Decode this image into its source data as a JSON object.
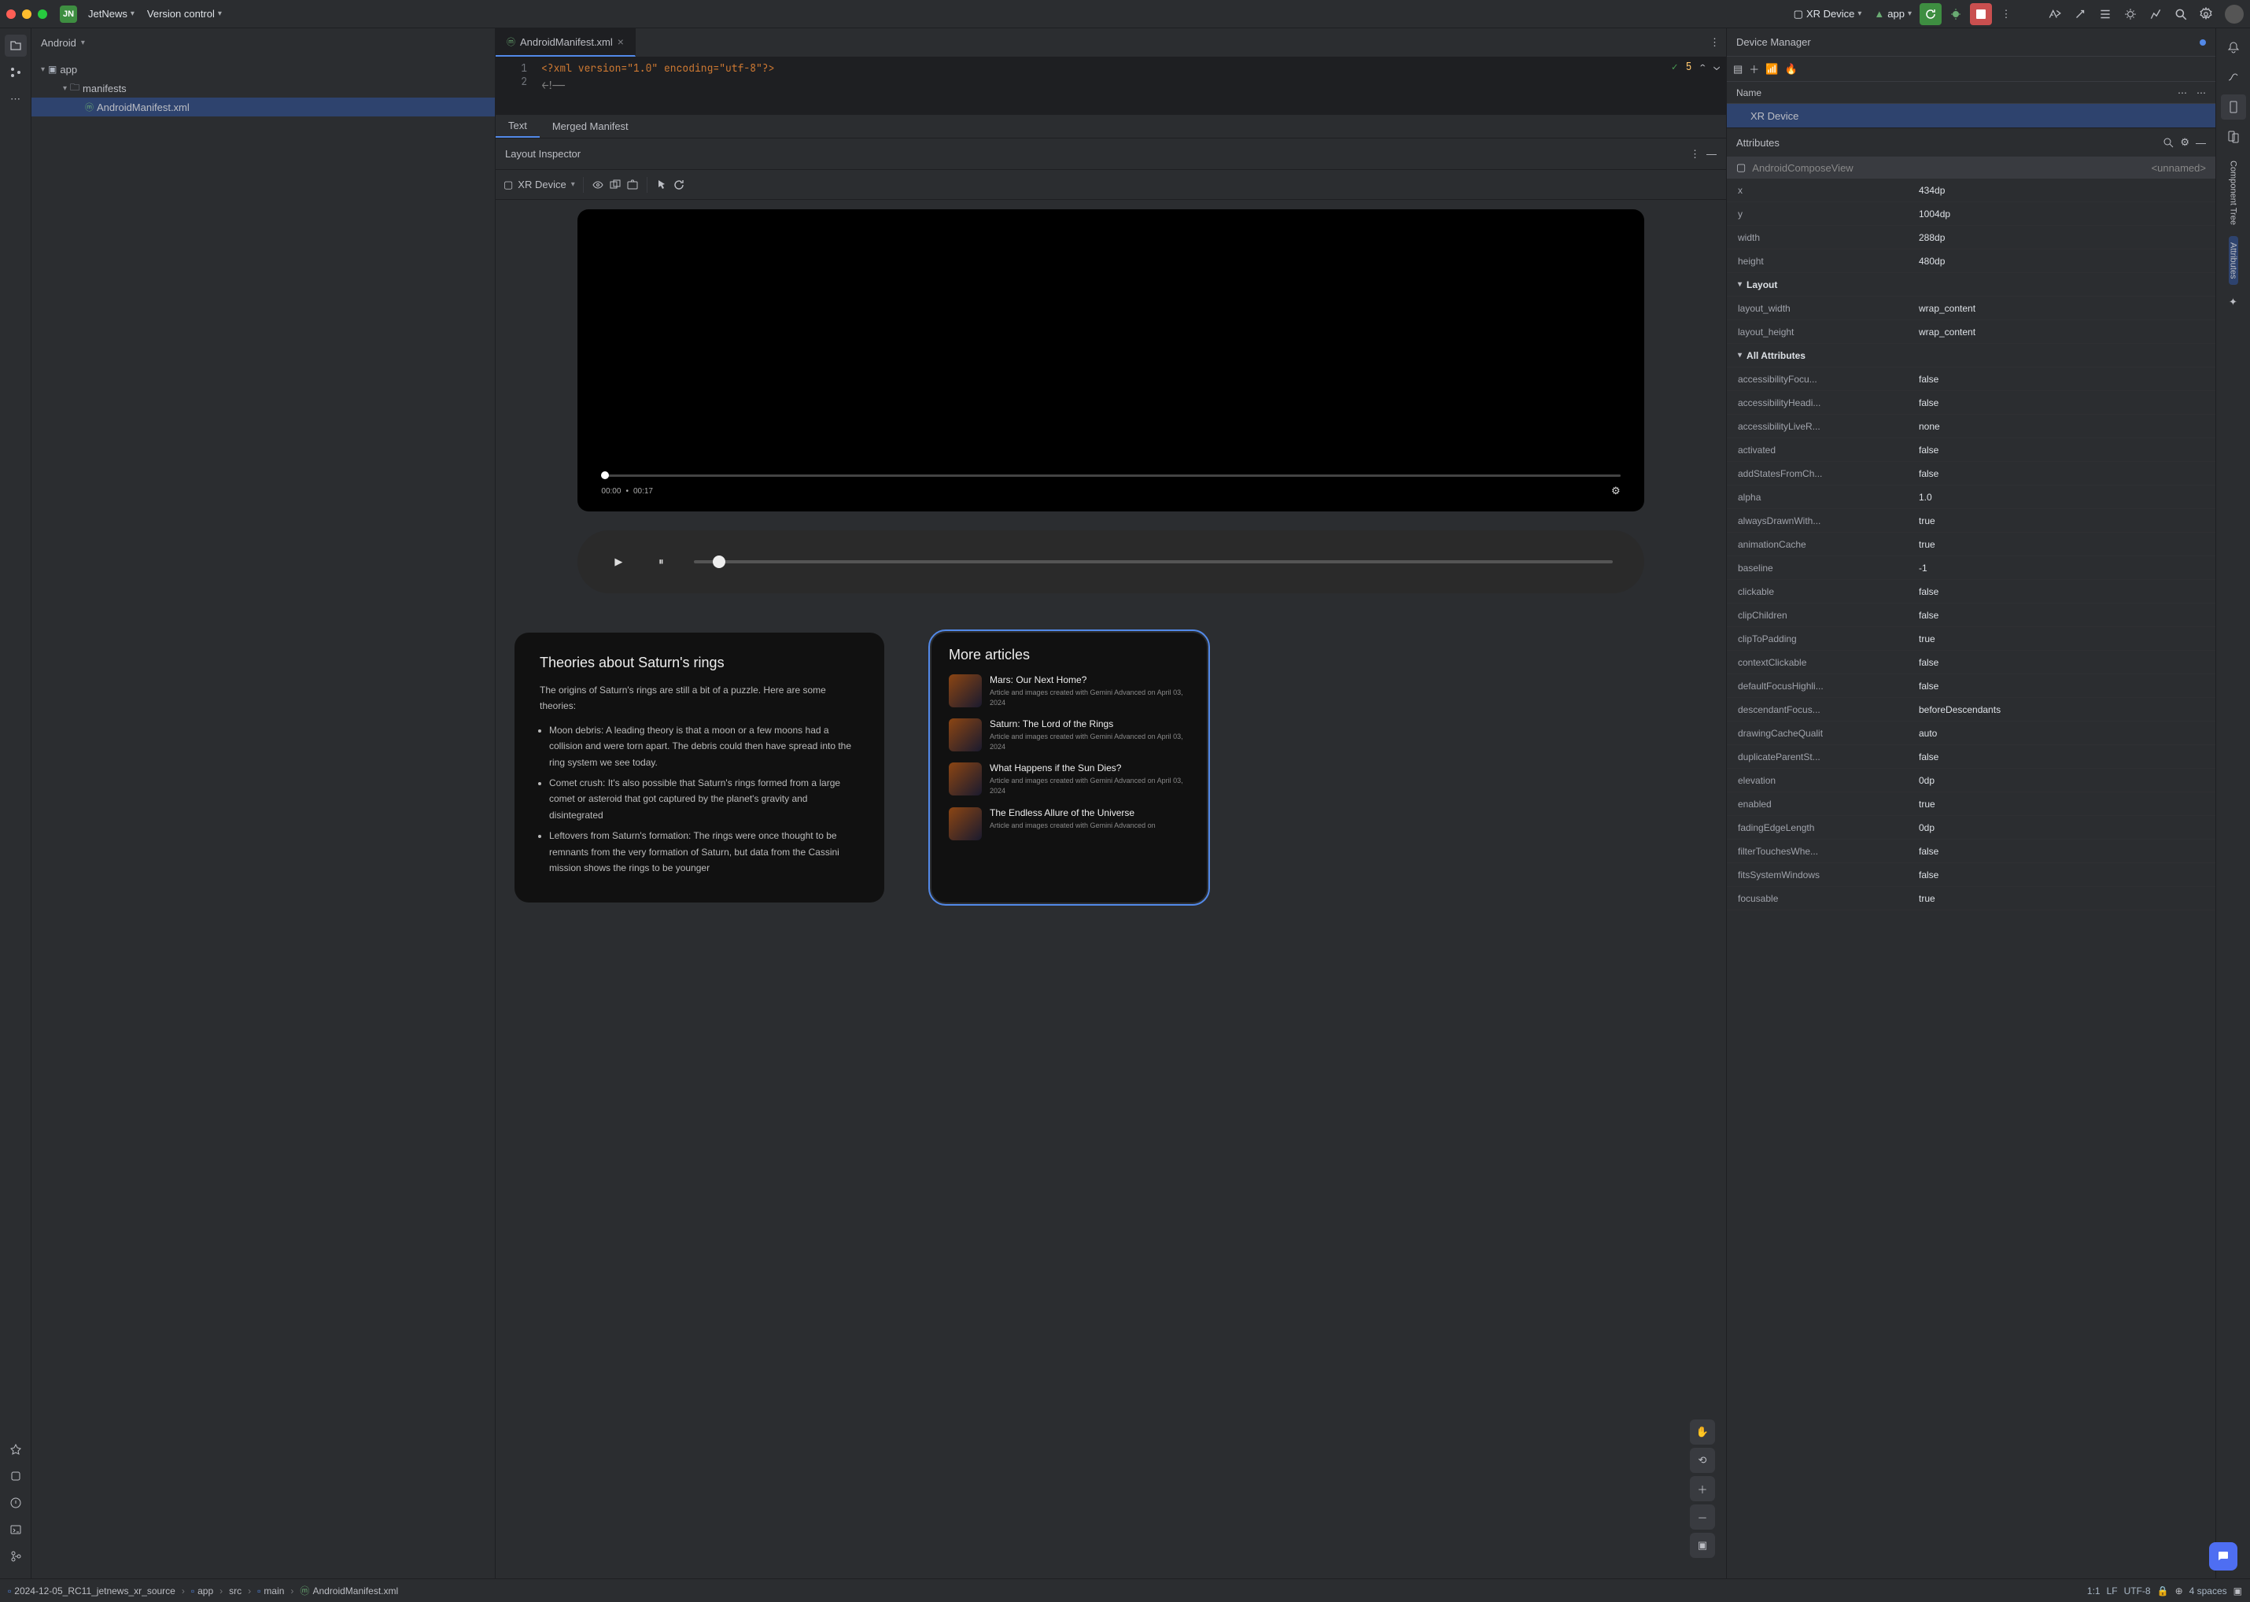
{
  "toolbar": {
    "project_badge": "JN",
    "project_name": "JetNews",
    "vcs": "Version control",
    "run_target": "XR Device",
    "run_config": "app"
  },
  "project_panel": {
    "title": "Android",
    "tree": {
      "root": "app",
      "manifests": "manifests",
      "manifest_file": "AndroidManifest.xml"
    }
  },
  "editor": {
    "tab_name": "AndroidManifest.xml",
    "line1_num": "1",
    "line2_num": "2",
    "code_line1": "<?xml version=\"1.0\" encoding=\"utf-8\"?>",
    "code_line2": "<!--",
    "issue_count": "5",
    "sub_text": "Text",
    "sub_merged": "Merged Manifest"
  },
  "inspector": {
    "title": "Layout Inspector",
    "device": "XR Device"
  },
  "video": {
    "time_current": "00:00",
    "time_sep": "•",
    "time_total": "00:17"
  },
  "article_main": {
    "heading": "Theories about Saturn's rings",
    "intro": "The origins of Saturn's rings are still a bit of a puzzle. Here are some theories:",
    "b1": "Moon debris: A leading theory is that a moon or a few moons had a collision and were torn apart. The debris could then have spread into the ring system we see today.",
    "b2": "Comet crush: It's also possible that Saturn's rings formed from a large comet or asteroid that got captured by the planet's gravity and disintegrated",
    "b3": "Leftovers from Saturn's formation: The rings were once thought to be remnants from the very formation of Saturn, but data from the Cassini mission shows the rings to be younger"
  },
  "more_articles": {
    "heading": "More articles",
    "items": [
      {
        "title": "Mars: Our Next Home?",
        "sub": "Article and images created with Gemini Advanced on April 03, 2024"
      },
      {
        "title": "Saturn: The Lord of the Rings",
        "sub": "Article and images created with Gemini Advanced on April 03, 2024"
      },
      {
        "title": "What Happens if the Sun Dies?",
        "sub": "Article and images created with Gemini Advanced on April 03, 2024"
      },
      {
        "title": "The Endless Allure of the Universe",
        "sub": "Article and images created with Gemini Advanced on"
      }
    ]
  },
  "device_manager": {
    "title": "Device Manager",
    "col_name": "Name",
    "row_device": "XR Device"
  },
  "attributes": {
    "title": "Attributes",
    "class_name": "AndroidComposeView",
    "unnamed": "<unnamed>",
    "basic": [
      {
        "k": "x",
        "v": "434dp"
      },
      {
        "k": "y",
        "v": "1004dp"
      },
      {
        "k": "width",
        "v": "288dp"
      },
      {
        "k": "height",
        "v": "480dp"
      }
    ],
    "section_layout": "Layout",
    "layout": [
      {
        "k": "layout_width",
        "v": "wrap_content"
      },
      {
        "k": "layout_height",
        "v": "wrap_content"
      }
    ],
    "section_all": "All Attributes",
    "all": [
      {
        "k": "accessibilityFocu...",
        "v": "false"
      },
      {
        "k": "accessibilityHeadi...",
        "v": "false"
      },
      {
        "k": "accessibilityLiveR...",
        "v": "none"
      },
      {
        "k": "activated",
        "v": "false"
      },
      {
        "k": "addStatesFromCh...",
        "v": "false"
      },
      {
        "k": "alpha",
        "v": "1.0"
      },
      {
        "k": "alwaysDrawnWith...",
        "v": "true"
      },
      {
        "k": "animationCache",
        "v": "true"
      },
      {
        "k": "baseline",
        "v": "-1"
      },
      {
        "k": "clickable",
        "v": "false"
      },
      {
        "k": "clipChildren",
        "v": "false"
      },
      {
        "k": "clipToPadding",
        "v": "true"
      },
      {
        "k": "contextClickable",
        "v": "false"
      },
      {
        "k": "defaultFocusHighli...",
        "v": "false"
      },
      {
        "k": "descendantFocus...",
        "v": "beforeDescendants"
      },
      {
        "k": "drawingCacheQualit",
        "v": "auto"
      },
      {
        "k": "duplicateParentSt...",
        "v": "false"
      },
      {
        "k": "elevation",
        "v": "0dp"
      },
      {
        "k": "enabled",
        "v": "true"
      },
      {
        "k": "fadingEdgeLength",
        "v": "0dp"
      },
      {
        "k": "filterTouchesWhe...",
        "v": "false"
      },
      {
        "k": "fitsSystemWindows",
        "v": "false"
      },
      {
        "k": "focusable",
        "v": "true"
      }
    ]
  },
  "right_strip": {
    "component_tree": "Component Tree",
    "attributes": "Attributes"
  },
  "breadcrumbs": {
    "b1": "2024-12-05_RC11_jetnews_xr_source",
    "b2": "app",
    "b3": "src",
    "b4": "main",
    "b5": "AndroidManifest.xml"
  },
  "status": {
    "pos": "1:1",
    "le": "LF",
    "enc": "UTF-8",
    "indent": "4 spaces"
  }
}
